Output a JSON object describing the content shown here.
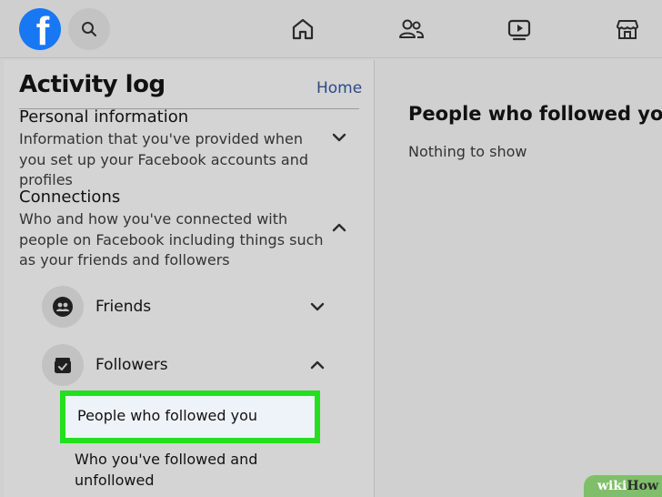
{
  "topbar": {
    "logo_letter": "f",
    "icons": [
      "search-icon",
      "home-icon",
      "friends-icon",
      "watch-icon",
      "marketplace-icon"
    ]
  },
  "activity_log": {
    "title": "Activity log",
    "home_link": "Home",
    "sections": [
      {
        "heading": "Personal information",
        "description": "Information that you've provided when you set up your Facebook accounts and profiles",
        "state": "collapsed"
      },
      {
        "heading": "Connections",
        "description": "Who and how you've connected with people on Facebook including things such as your friends and followers",
        "state": "expanded"
      }
    ],
    "subsections": [
      {
        "label": "Friends",
        "icon": "friends-icon",
        "state": "collapsed"
      },
      {
        "label": "Followers",
        "icon": "followers-icon",
        "state": "expanded"
      }
    ],
    "follower_items": [
      {
        "label": "People who followed you",
        "selected": true
      },
      {
        "label": "Who you've followed and unfollowed",
        "selected": false
      }
    ]
  },
  "content": {
    "title": "People who followed you",
    "empty_message": "Nothing to show"
  },
  "watermark": {
    "part1": "wiki",
    "part2": "How"
  },
  "colors": {
    "facebook_blue": "#1877f2",
    "highlight_green": "#22e01e",
    "link_blue": "#2a4a8a"
  }
}
